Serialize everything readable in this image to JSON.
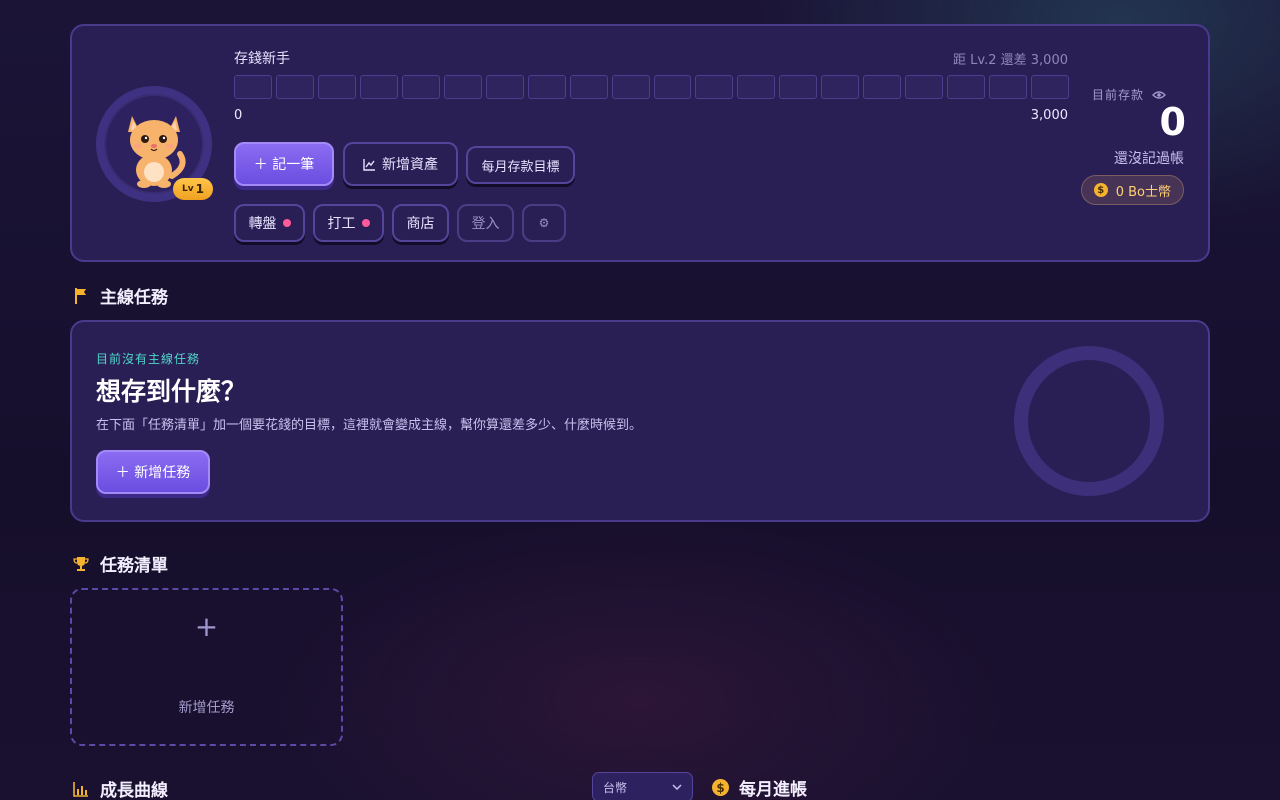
{
  "hero": {
    "rank_title": "存錢新手",
    "next_level_text": "距 Lv.2 還差 3,000",
    "segments": 20,
    "bar_min": "0",
    "bar_max": "3,000",
    "level_prefix": "Lv",
    "level": "1",
    "buttons": {
      "record": "＋ 記一筆",
      "add_asset": "新增資產",
      "monthly_goal": "每月存款目標",
      "wheel": "轉盤",
      "work": "打工",
      "shop": "商店",
      "login": "登入",
      "settings": "⚙"
    },
    "savings_label": "目前存款",
    "savings_value": "0",
    "savings_sub": "還沒記過帳",
    "coins": "0 Bo士幣"
  },
  "main_quest": {
    "section_title": "主線任務",
    "tag": "目前沒有主線任務",
    "title": "想存到什麼？",
    "description": "在下面「任務清單」加一個要花錢的目標，這裡就會變成主線，幫你算還差多少、什麼時候到。",
    "add_button": "＋ 新增任務"
  },
  "task_list": {
    "section_title": "任務清單",
    "add_plus": "+",
    "add_label": "新增任務"
  },
  "growth": {
    "section_title": "成長曲線",
    "currency_selected": "台幣"
  },
  "monthly_income": {
    "section_title": "每月進帳"
  },
  "colors": {
    "accent": "#7b5cf0",
    "coin": "#f4b22e",
    "teal": "#4fd6c8",
    "notify_dot": "#ff5a9a"
  }
}
